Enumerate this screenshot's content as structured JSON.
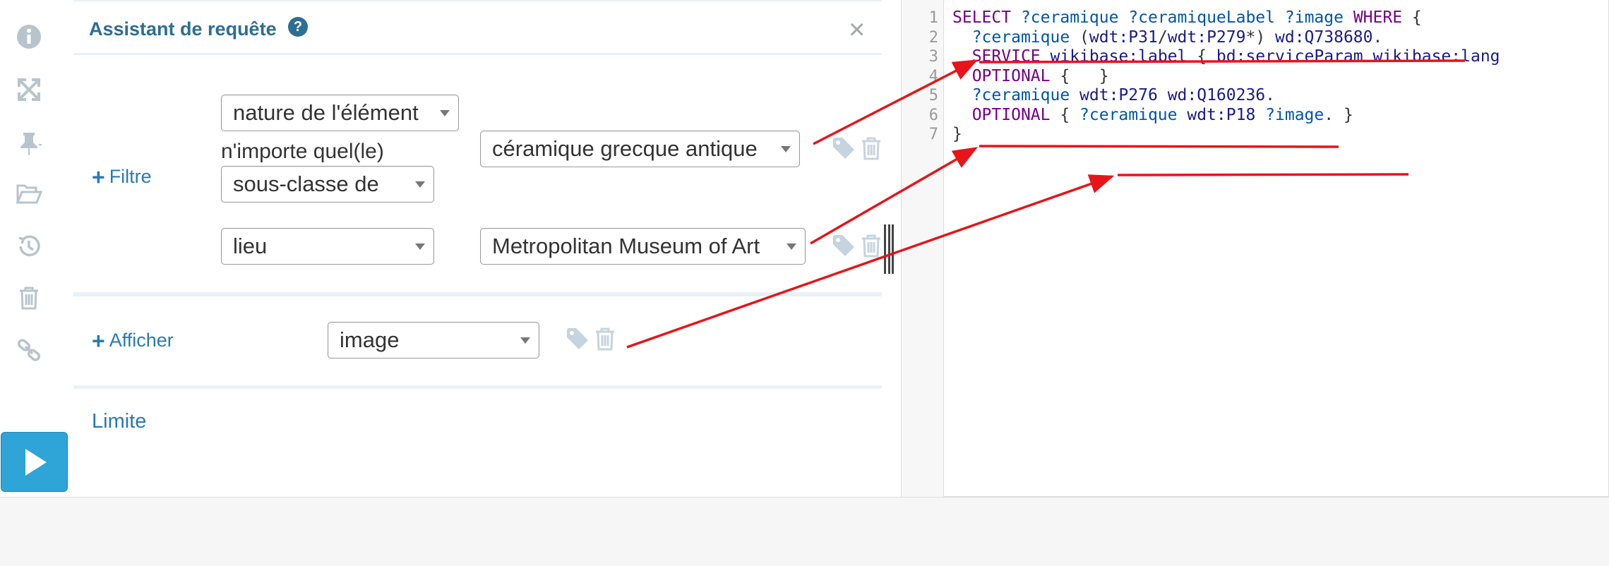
{
  "toolbar": {
    "icons": [
      "info-icon",
      "expand-icon",
      "pin-icon",
      "folder-open-icon",
      "history-icon",
      "trash-icon",
      "link-icon"
    ],
    "run_icon": "play-icon"
  },
  "helper": {
    "title": "Assistant de requête",
    "help_glyph": "?",
    "close_glyph": "×",
    "filter": {
      "label": "Filtre",
      "any_text": "n'importe quel(le)",
      "row1": {
        "property": "nature de l'élément",
        "property_path": "sous-classe de",
        "value": "céramique grecque antique"
      },
      "row2": {
        "property": "lieu",
        "value": "Metropolitan Museum of Art"
      }
    },
    "show": {
      "label": "Afficher",
      "property": "image"
    },
    "limit": {
      "label": "Limite"
    },
    "plus_glyph": "+"
  },
  "editor": {
    "line_numbers": [
      "1",
      "2",
      "3",
      "4",
      "5",
      "6",
      "7"
    ],
    "lines": [
      [
        {
          "t": "SELECT",
          "c": "kw"
        },
        {
          "t": " "
        },
        {
          "t": "?ceramique",
          "c": "var"
        },
        {
          "t": " "
        },
        {
          "t": "?ceramiqueLabel",
          "c": "var"
        },
        {
          "t": " "
        },
        {
          "t": "?image",
          "c": "var"
        },
        {
          "t": " "
        },
        {
          "t": "WHERE",
          "c": "kw"
        },
        {
          "t": " {"
        }
      ],
      [
        {
          "t": "  "
        },
        {
          "t": "?ceramique",
          "c": "var"
        },
        {
          "t": " ("
        },
        {
          "t": "wdt:P31",
          "c": "pfx"
        },
        {
          "t": "/"
        },
        {
          "t": "wdt:P279",
          "c": "pfx"
        },
        {
          "t": "*) "
        },
        {
          "t": "wd:Q738680",
          "c": "pfx"
        },
        {
          "t": "."
        }
      ],
      [
        {
          "t": "  "
        },
        {
          "t": "SERVICE",
          "c": "kw"
        },
        {
          "t": " "
        },
        {
          "t": "wikibase:label",
          "c": "pfx"
        },
        {
          "t": " { "
        },
        {
          "t": "bd:serviceParam",
          "c": "pfx"
        },
        {
          "t": " "
        },
        {
          "t": "wikibase:lang",
          "c": "pfx"
        }
      ],
      [
        {
          "t": "  "
        },
        {
          "t": "OPTIONAL",
          "c": "kw"
        },
        {
          "t": " {   }"
        }
      ],
      [
        {
          "t": "  "
        },
        {
          "t": "?ceramique",
          "c": "var"
        },
        {
          "t": " "
        },
        {
          "t": "wdt:P276",
          "c": "pfx"
        },
        {
          "t": " "
        },
        {
          "t": "wd:Q160236",
          "c": "pfx"
        },
        {
          "t": "."
        }
      ],
      [
        {
          "t": "  "
        },
        {
          "t": "OPTIONAL",
          "c": "kw"
        },
        {
          "t": " { "
        },
        {
          "t": "?ceramique",
          "c": "var"
        },
        {
          "t": " "
        },
        {
          "t": "wdt:P18",
          "c": "pfx"
        },
        {
          "t": " "
        },
        {
          "t": "?image",
          "c": "var"
        },
        {
          "t": ". }"
        }
      ],
      [
        {
          "t": "}"
        }
      ]
    ]
  },
  "annotations": {
    "color": "#e8141a"
  },
  "colors": {
    "accent": "#2d6e93",
    "link": "#2a79b5",
    "run_button": "#2fa4d6",
    "keyword": "#770088",
    "variable": "#0055aa"
  }
}
